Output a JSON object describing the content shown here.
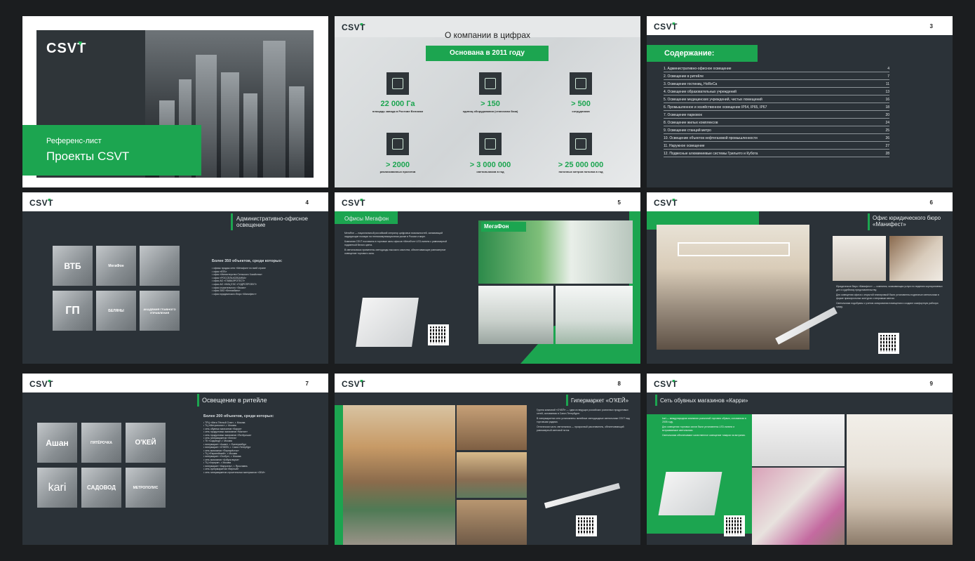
{
  "brand": "CSVT",
  "slide1": {
    "subtitle": "Референс-лист",
    "title": "Проекты CSVT"
  },
  "slide2": {
    "heading": "О компании в цифрах",
    "founded": "Основана в 2011 году",
    "stats": [
      {
        "value": "22 000 Га",
        "label": "площадь завода в Ростове Великом",
        "icon": "factory-icon"
      },
      {
        "value": "> 150",
        "label": "единиц оборудования (станочная база)",
        "icon": "machine-icon"
      },
      {
        "value": "> 500",
        "label": "сотрудников",
        "icon": "workers-icon"
      },
      {
        "value": "> 2000",
        "label": "реализованных проектов",
        "icon": "blueprint-icon"
      },
      {
        "value": "> 3 000 000",
        "label": "светильников в год",
        "icon": "cart-icon"
      },
      {
        "value": "> 25 000 000",
        "label": "погонных метров потолка в год",
        "icon": "ceiling-icon"
      }
    ]
  },
  "slide3": {
    "page": "3",
    "title": "Содержание:",
    "toc": [
      {
        "t": "1. Административно-офисное освещение",
        "p": "4"
      },
      {
        "t": "2. Освещение в ритейле",
        "p": "7"
      },
      {
        "t": "3. Освещение гостиниц, HoReCa",
        "p": "11"
      },
      {
        "t": "4. Освещение образовательных учреждений",
        "p": "13"
      },
      {
        "t": "5. Освещение медицинских учреждений, чистых помещений",
        "p": "16"
      },
      {
        "t": "6. Промышленное и хозяйственное освещение IP54, IP65, IP67",
        "p": "18"
      },
      {
        "t": "7. Освещение парковок",
        "p": "20"
      },
      {
        "t": "8. Освещение жилых комплексов",
        "p": "24"
      },
      {
        "t": "9. Освещение станций метро",
        "p": "25"
      },
      {
        "t": "10. Освещение объектов нефтегазовой промышленности",
        "p": "26"
      },
      {
        "t": "11. Наружное освещение",
        "p": "27"
      },
      {
        "t": "12. Подвесные алюминиевые системы Грильято и Кубота",
        "p": "28"
      }
    ]
  },
  "slide4": {
    "page": "4",
    "header": "Административно-офисное освещение",
    "logos": [
      "ВТБ",
      "МегаФон",
      "",
      "ГП",
      "БЕЛЯНЫ",
      "АКАДЕМИЯ ГЛАВНОГО УПРАВЛЕНИЯ"
    ],
    "list_title": "Более 350 объектов, среди которых:",
    "list": [
      "• офисы продаж сети «Мегафон» по всей стране",
      "• офис «ВТБ»",
      "• офис «Министерство Сельского Хозяйства»",
      "• офис «РОССЕЛЬХОЗБАНКА»",
      "• офис АО «ГЛАВАЭРОТЕСТ»",
      "• офис АО «НИЦ ЕЭС «ГИДРОПРОЕКТ»",
      "• офис строительного «Эксмо»",
      "• офис ЗАО «Белгазбанк»",
      "• офис юридического бюро «Манифест»"
    ]
  },
  "slide5": {
    "page": "5",
    "header": "Офисы Мегафон",
    "store_sign": "МегаФон",
    "text": [
      "МегаФон — национальный российский оператор цифровых возможностей, занимающий лидирующие позиции на телекоммуникационном рынке в России и мире.",
      "Компания CSVT поставила в торговые залы офисов «МегаФон» LED-панели с равномерной подсветкой белого цвета.",
      "В светильниках применены светодиоды высокого качества, обеспечивающие равномерное освещение торгового зала."
    ]
  },
  "slide6": {
    "page": "6",
    "header": "Офис юридического бюро «Манифест»",
    "text": [
      "Юридическое бюро «Манифест» — компания, оказывающая услуги по ведению корпоративных дел и судебному представительству.",
      "Для освещения офиса с открытой планировкой были установлены подвесные светильники в форме прямоугольных контуров с непрямым светом.",
      "Светильники подобраны с учетом зонирования помещения и создают комфортную рабочую среду."
    ]
  },
  "slide7": {
    "page": "7",
    "header": "Освещение в ритейле",
    "logos": [
      "Ашан",
      "ПЯТЁРОЧКА",
      "О'КЕЙ",
      "kari",
      "САДОВОД",
      "МЕТРОПОЛИС"
    ],
    "list_title": "Более 200 объектов, среди которых:",
    "list": [
      "• ТРЦ «Мега Тёплый Стан», г. Москва",
      "• ТЦ «Метрополис», г. Москва",
      "• сеть обувных магазинов «Карри»",
      "• сеть продуктовых магазинов «Магнит»",
      "• сеть продуктовых магазинов «Пятёрочка»",
      "• сеть гипермаркетов «Лента»",
      "• ТК «Садовод», г. Москва",
      "• гипермаркет «Ашан», г. Екатеринбург",
      "• гипермаркет «О'КЕЙ», г. Санкт-Петербург",
      "• сеть магазинов «Перекрёсток»",
      "• ТЦ «Европейский», г. Москва",
      "• гипермаркет «Глобус», г. Москва",
      "• сеть магазинов «Азбука вкуса»",
      "• ТЦ «Атриум», г. Москва",
      "• гипермаркет «Карусель», г. Ярославль",
      "• сеть супермаркетов «Верный»",
      "• сеть гипермаркетов строительных материалов «ОБИ»"
    ]
  },
  "slide8": {
    "page": "8",
    "header": "Гипермаркет «О'КЕЙ»",
    "text": [
      "Группа компаний «О'КЕЙ» — одна из ведущих российских розничных продуктовых сетей, основанная в Санкт-Петербурге.",
      "В гипермаркетах сети установлены линейные светодиодные светильники CSVT над торговыми рядами.",
      "Оптическая часть светильника — прозрачный рассеиватель, обеспечивающий равномерный световой поток."
    ]
  },
  "slide9": {
    "page": "9",
    "header": "Сеть обувных магазинов «Карри»",
    "text": [
      "kari — международная компания розничной торговли обувью, основанная в 2005 году.",
      "Для освещения торговых залов были установлены LED-панели и встраиваемые светильники.",
      "Светильники обеспечивают качественное освещение товаров на витринах."
    ]
  }
}
